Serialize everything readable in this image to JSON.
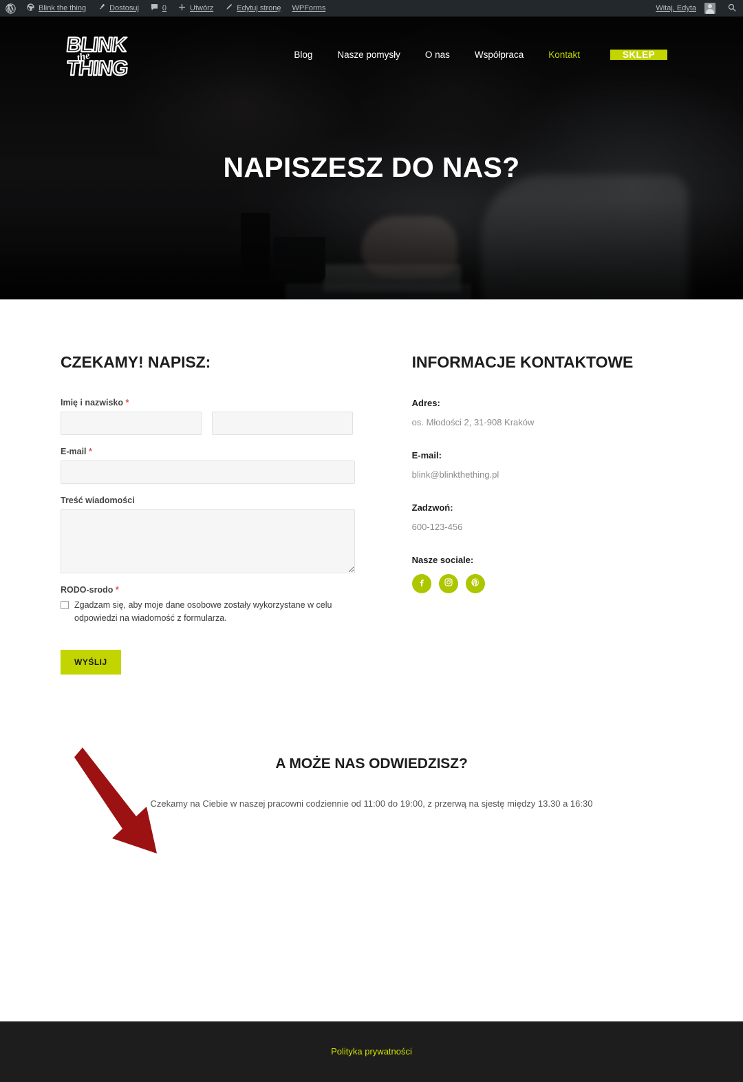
{
  "adminbar": {
    "wp_icon": "wordpress-icon",
    "site_name": "Blink the thing",
    "customize": "Dostosuj",
    "comments_count": "0",
    "new": "Utwórz",
    "edit_page": "Edytuj stronę",
    "wpforms": "WPForms",
    "greeting": "Witaj, Edyta"
  },
  "header": {
    "logo_line1": "BLINK",
    "logo_line2": "the",
    "logo_line3": "THING",
    "nav": [
      {
        "label": "Blog",
        "active": false
      },
      {
        "label": "Nasze pomysły",
        "active": false
      },
      {
        "label": "O nas",
        "active": false
      },
      {
        "label": "Współpraca",
        "active": false
      },
      {
        "label": "Kontakt",
        "active": true
      }
    ],
    "shop_button": "SKLEP"
  },
  "hero": {
    "title": "NAPISZESZ DO NAS?"
  },
  "form": {
    "heading": "CZEKAMY! NAPISZ:",
    "name_label": "Imię i nazwisko",
    "name_required": "*",
    "name_first_value": "",
    "name_last_value": "",
    "email_label": "E-mail",
    "email_required": "*",
    "email_value": "",
    "message_label": "Treść wiadomości",
    "message_value": "",
    "rodo_label": "RODO-srodo",
    "rodo_required": "*",
    "consent_text": "Zgadzam się, aby moje dane osobowe zostały wykorzystane w celu odpowiedzi na wiadomość z formularza.",
    "submit_label": "WYŚLIJ"
  },
  "contact": {
    "heading": "INFORMACJE KONTAKTOWE",
    "address_label": "Adres:",
    "address_value": "os. Młodości 2, 31-908 Kraków",
    "email_label": "E-mail:",
    "email_value": "blink@blinkthething.pl",
    "phone_label": "Zadzwoń:",
    "phone_value": "600-123-456",
    "socials_label": "Nasze sociale:",
    "socials": [
      {
        "name": "facebook-icon",
        "glyph": "f"
      },
      {
        "name": "instagram-icon",
        "glyph": "◎"
      },
      {
        "name": "pinterest-icon",
        "glyph": "P"
      }
    ]
  },
  "visit": {
    "heading": "A MOŻE NAS ODWIEDZISZ?",
    "text": "Czekamy na Ciebie w naszej pracowni codziennie od 11:00 do 19:00, z przerwą na sjestę między 13.30 a 16:30"
  },
  "footer": {
    "privacy_link": "Polityka prywatności"
  },
  "annotation": {
    "arrow_color": "#9C1111"
  },
  "colors": {
    "accent": "#c2d500",
    "social": "#aec600",
    "footer_link": "#d1e000",
    "admin_bar": "#23282d",
    "footer_bg": "#1d1d1d",
    "required_star": "#e25252"
  }
}
